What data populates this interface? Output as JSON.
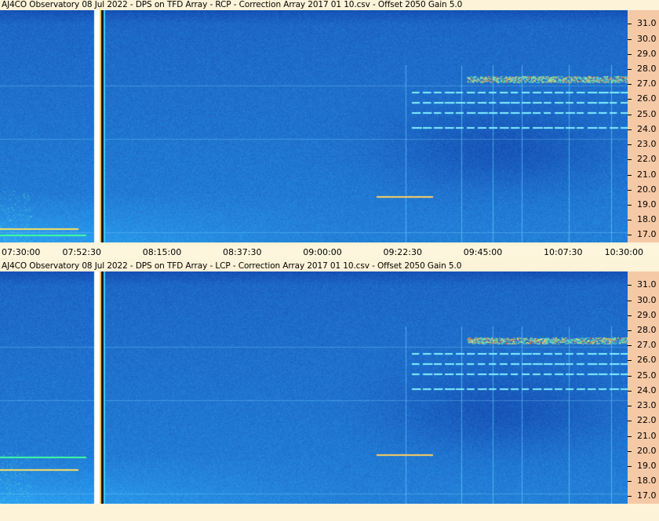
{
  "chart_data": [
    {
      "type": "heatmap",
      "title": "AJ4CO Observatory 08  Jul 2022  -  DPS on TFD Array  -  RCP  -  Correction Array 2017 01 10.csv  -  Offset 2050  Gain 5.0",
      "xlabel": "",
      "ylabel": "",
      "x_ticks": [
        "07:30:00",
        "07:52:30",
        "08:15:00",
        "08:37:30",
        "09:00:00",
        "09:22:30",
        "09:45:00",
        "10:07:30",
        "10:30:00"
      ],
      "y_ticks": [
        "31.0",
        "30.0",
        "29.0",
        "28.0",
        "27.0",
        "26.0",
        "25.0",
        "24.0",
        "23.0",
        "22.0",
        "21.0",
        "20.0",
        "19.0",
        "18.0",
        "17.0"
      ],
      "ylim": [
        16.5,
        31.9
      ],
      "colormap": [
        "#0a1f8f",
        "#0e3fbf",
        "#1565e0",
        "#2a8cf0",
        "#45c7f0",
        "#ffff60",
        "#ff6020",
        "#ffffff"
      ]
    },
    {
      "type": "heatmap",
      "title": "AJ4CO Observatory 08  Jul 2022  -  DPS on TFD Array  -  LCP  -  Correction Array 2017 01 10.csv  -  Offset 2050  Gain 5.0",
      "xlabel": "",
      "ylabel": "",
      "y_ticks": [
        "31.0",
        "30.0",
        "29.0",
        "28.0",
        "27.0",
        "26.0",
        "25.0",
        "24.0",
        "23.0",
        "22.0",
        "21.0",
        "20.0",
        "19.0",
        "18.0",
        "17.0"
      ],
      "ylim": [
        16.5,
        31.9
      ],
      "colormap": [
        "#0a1f8f",
        "#0e3fbf",
        "#1565e0",
        "#2a8cf0",
        "#45c7f0",
        "#ffff60",
        "#ff6020",
        "#ffffff"
      ]
    }
  ]
}
